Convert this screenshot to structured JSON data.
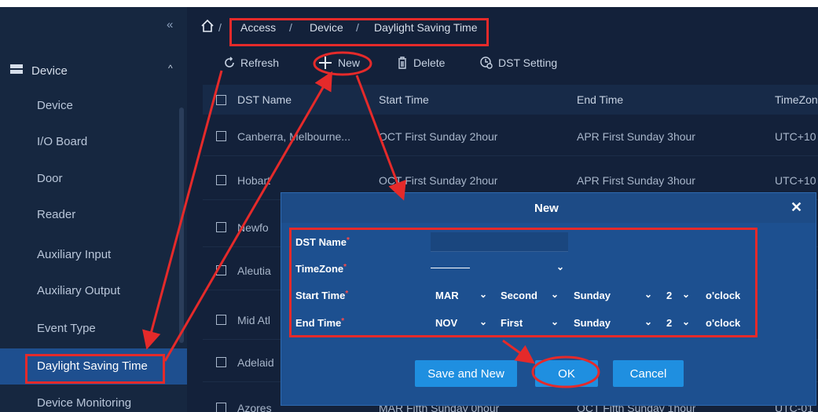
{
  "breadcrumb": {
    "items": [
      "Access",
      "Device",
      "Daylight Saving Time"
    ],
    "separator": "/"
  },
  "sidebar": {
    "collapse_icon": "double-chevron-left-icon",
    "group": {
      "label": "Device",
      "icon": "device-icon"
    },
    "items": [
      {
        "label": "Device"
      },
      {
        "label": "I/O Board"
      },
      {
        "label": "Door"
      },
      {
        "label": "Reader"
      },
      {
        "label": "Auxiliary Input"
      },
      {
        "label": "Auxiliary Output"
      },
      {
        "label": "Event Type"
      },
      {
        "label": "Daylight Saving Time"
      },
      {
        "label": "Device Monitoring"
      }
    ]
  },
  "toolbar": {
    "refresh": "Refresh",
    "new": "New",
    "delete": "Delete",
    "dst_setting": "DST Setting"
  },
  "table": {
    "headers": [
      "DST Name",
      "Start Time",
      "End Time",
      "TimeZon"
    ],
    "rows": [
      {
        "name": "Canberra, Melbourne...",
        "start": "OCT First Sunday 2hour",
        "end": "APR First Sunday 3hour",
        "tz": "UTC+10"
      },
      {
        "name": "Hobart",
        "start": "OCT First Sunday 2hour",
        "end": "APR First Sunday 3hour",
        "tz": "UTC+10"
      },
      {
        "name": "Newfo",
        "start": "",
        "end": "",
        "tz": ""
      },
      {
        "name": "Aleutia",
        "start": "",
        "end": "",
        "tz": ""
      },
      {
        "name": "Mid Atl",
        "start": "",
        "end": "",
        "tz": ""
      },
      {
        "name": "Adelaid",
        "start": "",
        "end": "",
        "tz": ""
      },
      {
        "name": "Azores",
        "start": "MAR Fifth Sunday 0hour",
        "end": "OCT Fifth Sunday 1hour",
        "tz": "UTC-01"
      }
    ]
  },
  "dialog": {
    "title": "New",
    "close_icon": "close-icon",
    "fields": {
      "dst_name": {
        "label": "DST Name",
        "value": ""
      },
      "timezone": {
        "label": "TimeZone",
        "value": "———"
      },
      "start_time": {
        "label": "Start Time",
        "month": "MAR",
        "week": "Second",
        "day": "Sunday",
        "hour": "2",
        "suffix": "o'clock"
      },
      "end_time": {
        "label": "End Time",
        "month": "NOV",
        "week": "First",
        "day": "Sunday",
        "hour": "2",
        "suffix": "o'clock"
      }
    },
    "buttons": {
      "save_new": "Save and New",
      "ok": "OK",
      "cancel": "Cancel"
    }
  },
  "colors": {
    "annotation": "#e52a2a",
    "accent": "#1f8fe0",
    "sidebar_active": "#1e4f8f"
  }
}
